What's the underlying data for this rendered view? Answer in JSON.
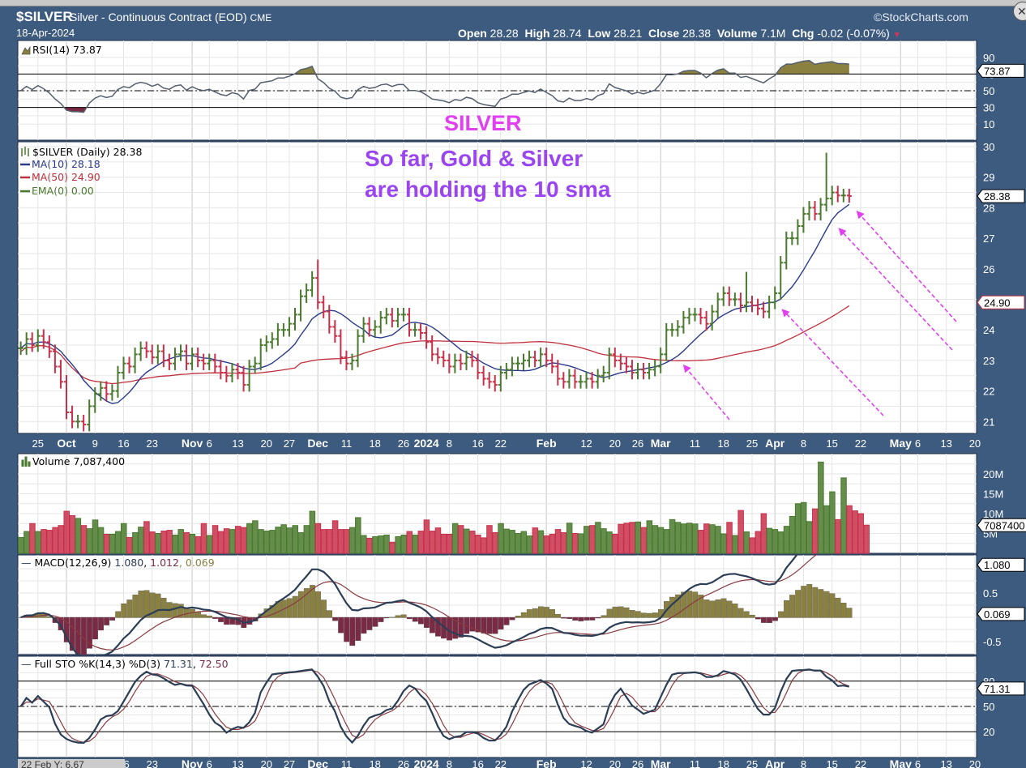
{
  "header": {
    "symbol": "$SILVER",
    "description": "Silver - Continuous Contract (EOD)",
    "exchange": "CME",
    "date": "18-Apr-2024",
    "brand": "©StockCharts.com",
    "open_label": "Open",
    "open": "28.28",
    "high_label": "High",
    "high": "28.74",
    "low_label": "Low",
    "low": "28.21",
    "close_label": "Close",
    "close": "28.38",
    "volume_label": "Volume",
    "volume": "7.1M",
    "chg_label": "Chg",
    "chg": "-0.02 (-0.07%)",
    "chg_arrow": "▼"
  },
  "crosshair_readout": "22 Feb Y: 6.67",
  "annotations": {
    "silver": "SILVER",
    "note_line1": "So far, Gold & Silver",
    "note_line2": "are holding the 10 sma",
    "magenta": "#e040f0",
    "purple": "#9b45f0"
  },
  "colors": {
    "up": "#4a7a2e",
    "down": "#c8304a",
    "ma10": "#2a3a8c",
    "ma50": "#c0303c",
    "macd": "#2c3e55",
    "signal": "#8a3a40",
    "hist_pos": "#8a8040",
    "hist_neg": "#7a2a44",
    "panel_bg": "#ffffff",
    "frame": "#3d5b7f"
  },
  "chart_data": {
    "type": "ohlc-bar",
    "start_date": "2023-09-20",
    "end_date": "2024-04-18",
    "close": [
      23.4,
      23.7,
      23.5,
      23.8,
      23.6,
      23.3,
      22.8,
      22.3,
      21.3,
      21.0,
      21.0,
      20.9,
      21.5,
      21.9,
      22.1,
      21.9,
      22.0,
      22.6,
      22.9,
      22.8,
      23.2,
      23.4,
      23.3,
      23.1,
      23.3,
      23.0,
      22.9,
      23.2,
      23.3,
      22.9,
      23.2,
      23.0,
      22.9,
      23.0,
      22.8,
      22.6,
      22.5,
      22.7,
      22.6,
      22.2,
      22.8,
      22.9,
      23.5,
      23.6,
      23.7,
      24.0,
      24.0,
      24.2,
      24.5,
      25.1,
      25.3,
      25.7,
      24.9,
      24.6,
      24.1,
      23.8,
      23.1,
      22.9,
      23.0,
      23.8,
      24.2,
      24.0,
      24.1,
      24.4,
      24.5,
      24.3,
      24.5,
      24.5,
      24.0,
      24.0,
      23.9,
      23.6,
      23.2,
      23.1,
      23.0,
      22.8,
      23.0,
      22.9,
      23.1,
      23.0,
      22.6,
      22.4,
      22.3,
      22.2,
      22.6,
      22.7,
      22.9,
      22.9,
      23.0,
      23.1,
      23.0,
      23.2,
      23.0,
      22.8,
      22.4,
      22.3,
      22.5,
      22.3,
      22.3,
      22.4,
      22.3,
      22.5,
      22.6,
      23.2,
      23.0,
      22.9,
      22.8,
      22.6,
      22.7,
      22.6,
      22.7,
      22.8,
      23.2,
      24.0,
      24.0,
      24.1,
      24.4,
      24.5,
      24.5,
      24.4,
      24.2,
      24.6,
      25.0,
      25.2,
      25.0,
      25.0,
      24.8,
      24.9,
      24.8,
      24.7,
      24.6,
      24.9,
      25.2,
      26.2,
      27.0,
      27.0,
      27.4,
      27.8,
      28.0,
      27.8,
      28.1,
      28.3,
      28.5,
      28.4,
      28.4,
      28.38
    ],
    "high_overrides": {
      "52": 26.3,
      "127": 25.9,
      "141": 29.8
    },
    "volume_millions": [
      4.0,
      5.5,
      7.5,
      5.5,
      6.0,
      5.8,
      6.5,
      7.0,
      10.6,
      9.5,
      8.8,
      7.0,
      6.2,
      8.4,
      6.5,
      4.8,
      4.8,
      5.5,
      7.5,
      4.0,
      5.2,
      6.6,
      8.0,
      5.4,
      5.0,
      5.6,
      5.8,
      4.6,
      6.0,
      5.2,
      4.8,
      4.2,
      7.5,
      4.5,
      7.0,
      5.5,
      6.2,
      6.0,
      6.8,
      6.5,
      7.5,
      8.2,
      6.0,
      5.6,
      5.8,
      6.6,
      7.2,
      6.4,
      7.0,
      5.2,
      7.0,
      10.6,
      7.5,
      6.0,
      6.0,
      8.2,
      6.0,
      6.0,
      6.5,
      9.0,
      4.5,
      3.8,
      4.2,
      4.4,
      4.6,
      2.8,
      4.2,
      4.6,
      5.5,
      4.6,
      5.6,
      8.4,
      5.6,
      6.4,
      4.8,
      4.8,
      7.5,
      7.0,
      6.1,
      5.6,
      4.6,
      3.9,
      7.0,
      5.2,
      7.5,
      6.1,
      5.8,
      5.0,
      5.5,
      4.4,
      6.4,
      5.7,
      4.4,
      4.8,
      6.0,
      5.2,
      7.6,
      5.0,
      4.9,
      6.8,
      7.0,
      7.8,
      6.2,
      5.4,
      4.8,
      7.3,
      7.6,
      7.8,
      7.9,
      6.5,
      8.2,
      7.0,
      6.5,
      6.0,
      8.5,
      7.8,
      7.4,
      7.6,
      7.4,
      5.8,
      7.4,
      7.2,
      6.8,
      4.9,
      7.8,
      4.5,
      10.8,
      5.4,
      3.9,
      5.5,
      10.0,
      6.3,
      6.0,
      5.4,
      6.8,
      9.3,
      12.5,
      12.8,
      8.0,
      11.2,
      23.0,
      12.0,
      15.5,
      8.5,
      19.0,
      12.0,
      10.7,
      10.0,
      7.1
    ],
    "panels": [
      {
        "name": "RSI",
        "legend": "RSI(14) 73.87",
        "last": "73.87",
        "ticks": [
          "90",
          "70",
          "50",
          "30",
          "10"
        ],
        "overbought": 70,
        "oversold": 30
      },
      {
        "name": "Price",
        "legend": "$SILVER (Daily) 28.38",
        "ma10_legend": "MA(10) 28.18",
        "ma50_legend": "MA(50) 24.90",
        "ema_legend": "EMA(0) 0.00",
        "last": "28.38",
        "ma50_last": "24.90",
        "ticks": [
          "30",
          "29",
          "28",
          "27",
          "26",
          "25",
          "24",
          "23",
          "22",
          "21"
        ],
        "ylim": [
          20.6,
          30.2
        ]
      },
      {
        "name": "Volume",
        "legend": "Volume 7,087,400",
        "last": "7087400",
        "ticks": [
          "20M",
          "15M",
          "10M",
          "5M"
        ]
      },
      {
        "name": "MACD",
        "legend_prefix": "MACD(12,26,9)",
        "macd": "1.080",
        "signal": "1.012",
        "hist": "0.069",
        "ticks": [
          "0.5",
          "-0.5"
        ]
      },
      {
        "name": "STO",
        "legend_prefix": "Full STO %K(14,3) %D(3)",
        "k": "71.31",
        "d": "72.50",
        "ticks": [
          "80",
          "50",
          "20"
        ]
      }
    ],
    "x_ticks": [
      [
        "25",
        3,
        0
      ],
      [
        "Oct",
        8,
        1
      ],
      [
        "9",
        13,
        0
      ],
      [
        "16",
        18,
        0
      ],
      [
        "23",
        23,
        0
      ],
      [
        "Nov",
        30,
        1
      ],
      [
        "6",
        33,
        0
      ],
      [
        "13",
        38,
        0
      ],
      [
        "20",
        43,
        0
      ],
      [
        "27",
        47,
        0
      ],
      [
        "Dec",
        52,
        1
      ],
      [
        "11",
        57,
        0
      ],
      [
        "18",
        62,
        0
      ],
      [
        "26",
        67,
        0
      ],
      [
        "2024",
        71,
        1
      ],
      [
        "8",
        75,
        0
      ],
      [
        "16",
        80,
        0
      ],
      [
        "22",
        84,
        0
      ],
      [
        "Feb",
        92,
        1
      ],
      [
        "12",
        99,
        0
      ],
      [
        "20",
        104,
        0
      ],
      [
        "26",
        108,
        0
      ],
      [
        "Mar",
        112,
        1
      ],
      [
        "11",
        118,
        0
      ],
      [
        "18",
        123,
        0
      ],
      [
        "25",
        128,
        0
      ],
      [
        "Apr",
        132,
        1
      ],
      [
        "8",
        137,
        0
      ],
      [
        "15",
        142,
        0
      ],
      [
        "22",
        147,
        0
      ],
      [
        "May",
        154,
        1
      ],
      [
        "6",
        157,
        0
      ],
      [
        "13",
        162,
        0
      ],
      [
        "20",
        167,
        0
      ]
    ]
  }
}
